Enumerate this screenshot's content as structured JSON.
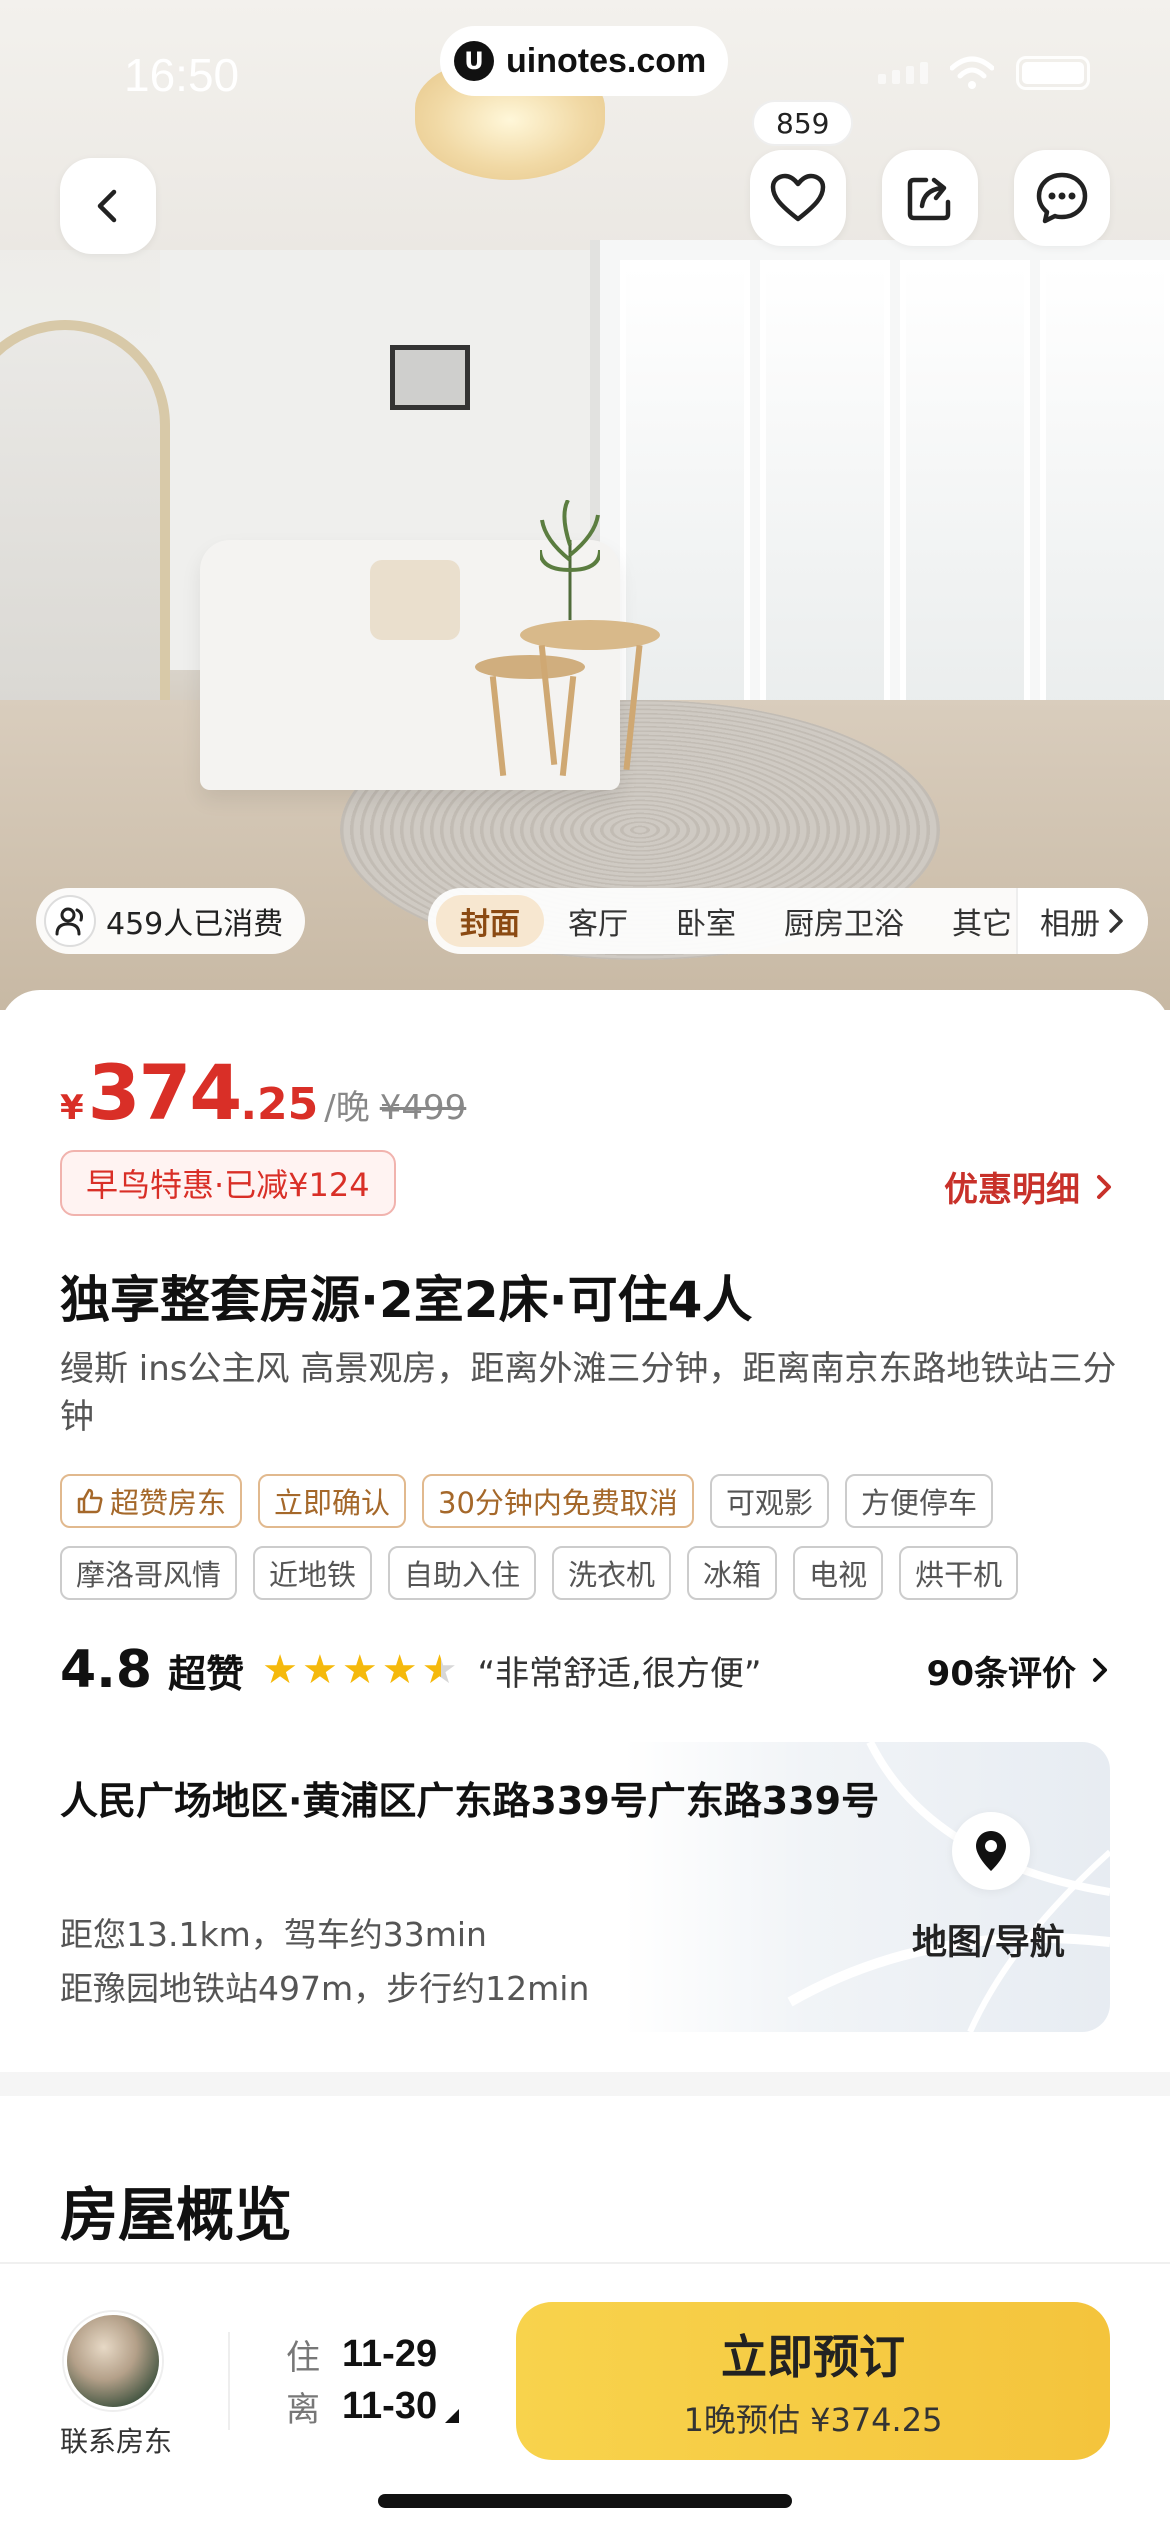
{
  "status_bar": {
    "time": "16:50",
    "url": "uinotes.com",
    "url_logo": "U"
  },
  "top_actions": {
    "back_icon": "chevron-left-icon",
    "favorite_count": "859",
    "favorite_icon": "heart-icon",
    "share_icon": "share-icon",
    "message_icon": "chat-bubble-icon"
  },
  "hero": {
    "consumed_text": "459人已消费",
    "tabs": [
      "封面",
      "客厅",
      "卧室",
      "厨房卫浴",
      "其它"
    ],
    "album_label": "相册"
  },
  "price": {
    "symbol": "¥",
    "integer": "374",
    "decimal": ".25",
    "unit": "/晚",
    "original": "¥499"
  },
  "promo": {
    "tag": "早鸟特惠·已减¥124",
    "detail_link": "优惠明细"
  },
  "listing": {
    "title": "独享整套房源·2室2床·可住4人",
    "subtitle": "缦斯 ins公主风 高景观房，距离外滩三分钟，距离南京东路地铁站三分钟"
  },
  "tags_gold": [
    "超赞房东",
    "立即确认",
    "30分钟内免费取消"
  ],
  "tags_plain": [
    "可观影",
    "方便停车",
    "摩洛哥风情",
    "近地铁",
    "自助入住",
    "洗衣机",
    "冰箱",
    "电视",
    "烘干机"
  ],
  "rating": {
    "score": "4.8",
    "label": "超赞",
    "stars": 4.5,
    "quote": "“非常舒适,很方便”",
    "reviews": "90条评价"
  },
  "address": {
    "title": "人民广场地区·黄浦区广东路339号广东路339号",
    "distance": "距您13.1km，驾车约33min",
    "metro": "距豫园地铁站497m，步行约12min",
    "map_label": "地图/导航"
  },
  "overview": {
    "title": "房屋概览"
  },
  "bottom_bar": {
    "host_label": "联系房东",
    "checkin_key": "住",
    "checkin_date": "11-29",
    "checkout_key": "离",
    "checkout_date": "11-30",
    "book_label": "立即预订",
    "book_sub": "1晚预估 ¥374.25"
  },
  "colors": {
    "price_red": "#d92f27",
    "book_yellow": "#f6cc44",
    "star_gold": "#f5b90c",
    "tag_gold": "#a5682a"
  }
}
